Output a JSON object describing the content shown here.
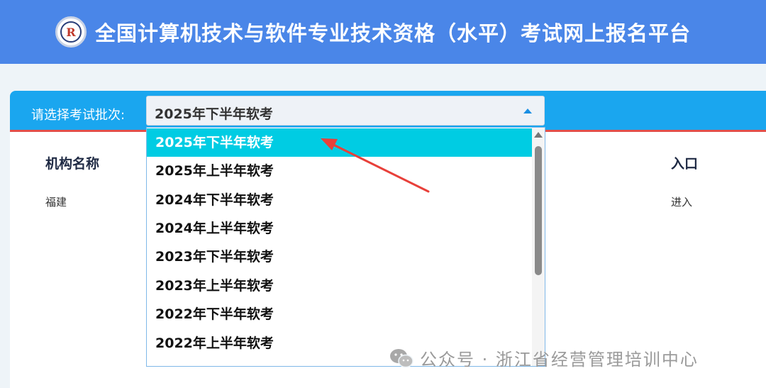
{
  "header": {
    "logo_letter": "R",
    "title": "全国计算机技术与软件专业技术资格（水平）考试网上报名平台"
  },
  "batch": {
    "label": "请选择考试批次:",
    "selected": "2025年下半年软考"
  },
  "table": {
    "columns": [
      "机构名称",
      "入口"
    ],
    "rows": [
      {
        "org": "福建",
        "entry": "进入"
      }
    ]
  },
  "dropdown": {
    "options": [
      "2025年下半年软考",
      "2025年上半年软考",
      "2024年下半年软考",
      "2024年上半年软考",
      "2023年下半年软考",
      "2023年上半年软考",
      "2022年下半年软考",
      "2022年上半年软考"
    ],
    "selected_index": 0
  },
  "watermark": {
    "text": "公众号 · 浙江省经营管理培训中心"
  },
  "colors": {
    "header_bg": "#4a86e8",
    "bar_bg": "#1aa6ef",
    "selected_option": "#00cce3",
    "annotation_arrow": "#e8403a"
  }
}
